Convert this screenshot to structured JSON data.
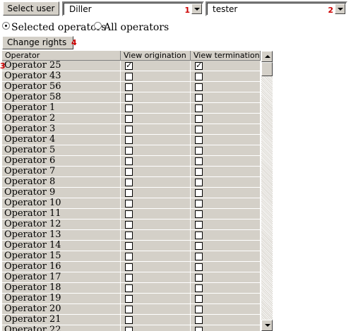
{
  "toolbar": {
    "select_user_label": "Select user",
    "combo1": {
      "value": "Diller",
      "marker": "1"
    },
    "combo2": {
      "value": "tester",
      "marker": "2"
    }
  },
  "scope": {
    "selected_label": "Selected operators",
    "all_label": "All operators",
    "selected": "selected"
  },
  "actions": {
    "change_rights_label": "Change rights",
    "change_rights_marker": "4"
  },
  "table": {
    "row_marker": "3",
    "headers": [
      "Operator",
      "View origination",
      "View termination"
    ],
    "rows": [
      {
        "name": "Operator 25",
        "orig": true,
        "term": true
      },
      {
        "name": "Operator 43",
        "orig": false,
        "term": false
      },
      {
        "name": "Operator 56",
        "orig": false,
        "term": false
      },
      {
        "name": "Operator 58",
        "orig": false,
        "term": false
      },
      {
        "name": "Operator 1",
        "orig": false,
        "term": false
      },
      {
        "name": "Operator 2",
        "orig": false,
        "term": false
      },
      {
        "name": "Operator 3",
        "orig": false,
        "term": false
      },
      {
        "name": "Operator 4",
        "orig": false,
        "term": false
      },
      {
        "name": "Operator 5",
        "orig": false,
        "term": false
      },
      {
        "name": "Operator 6",
        "orig": false,
        "term": false
      },
      {
        "name": "Operator 7",
        "orig": false,
        "term": false
      },
      {
        "name": "Operator 8",
        "orig": false,
        "term": false
      },
      {
        "name": "Operator 9",
        "orig": false,
        "term": false
      },
      {
        "name": "Operator 10",
        "orig": false,
        "term": false
      },
      {
        "name": "Operator 11",
        "orig": false,
        "term": false
      },
      {
        "name": "Operator 12",
        "orig": false,
        "term": false
      },
      {
        "name": "Operator 13",
        "orig": false,
        "term": false
      },
      {
        "name": "Operator 14",
        "orig": false,
        "term": false
      },
      {
        "name": "Operator 15",
        "orig": false,
        "term": false
      },
      {
        "name": "Operator 16",
        "orig": false,
        "term": false
      },
      {
        "name": "Operator 17",
        "orig": false,
        "term": false
      },
      {
        "name": "Operator 18",
        "orig": false,
        "term": false
      },
      {
        "name": "Operator 19",
        "orig": false,
        "term": false
      },
      {
        "name": "Operator 20",
        "orig": false,
        "term": false
      },
      {
        "name": "Operator 21",
        "orig": false,
        "term": false
      },
      {
        "name": "Operator 22",
        "orig": false,
        "term": false
      }
    ]
  },
  "colors": {
    "marker": "#cc0000",
    "face": "#d4d0c8"
  }
}
